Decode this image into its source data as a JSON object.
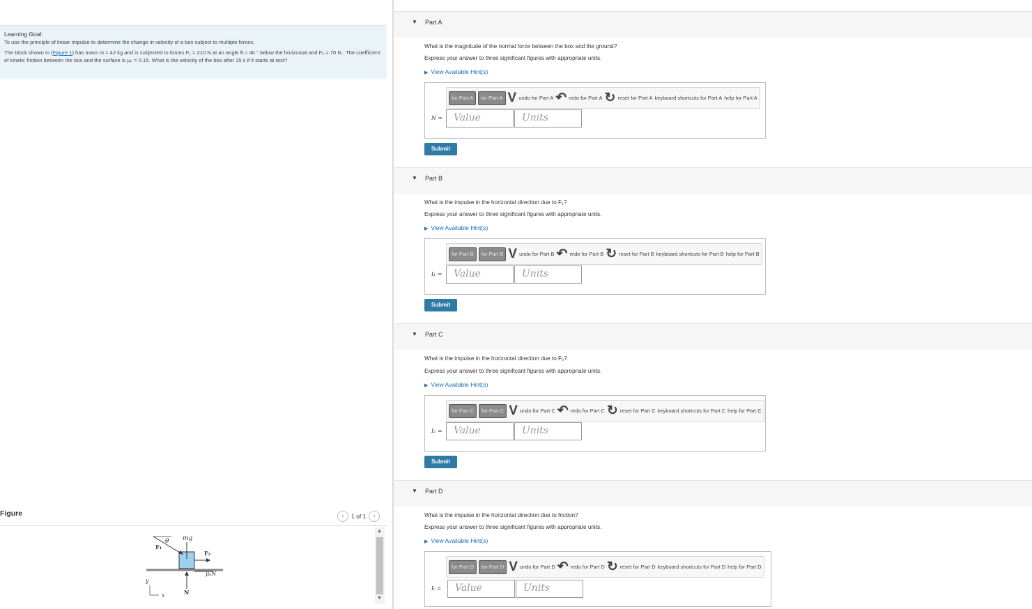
{
  "learning_goal": {
    "title": "Learning Goal:",
    "intro": "To use the principle of linear impulse to determine the change in velocity of a box subject to multiple forces.",
    "problem_prefix": "The block shown in (",
    "figure_link": "Figure 1",
    "problem_suffix": ") has mass m = 42 kg and is subjected to forces F₁ = 210 N at an angle θ = 40 ° below the horizontal and F₂ = 70 N . The coefficient of kinetic friction between the box and the surface is μₖ = 0.15. What is the velocity of the box after 15 s if it starts at rest?"
  },
  "figure": {
    "label": "Figure",
    "count": "1 of 1",
    "prev_icon": "chevron-left-icon",
    "next_icon": "chevron-right-icon",
    "labels": {
      "theta": "θ",
      "mg": "mg",
      "f1": "F₁",
      "f2": "F₂",
      "friction": "μₖN",
      "normal": "N",
      "y": "y",
      "x": "x"
    }
  },
  "parts": [
    {
      "title": "Part A",
      "question": "What is the magnitude of the normal force between the box and the ground?",
      "instruction": "Express your answer to three significant figures with appropriate units.",
      "hint": "View Available Hint(s)",
      "toolbar": {
        "btn1": "for Part A",
        "btn2": "for Part A",
        "undo": "undo for Part A",
        "redo": "redo for Part A",
        "reset": "reset for Part A",
        "shortcuts": "keyboard shortcuts for Part A",
        "help": "help for Part A"
      },
      "variable": "N =",
      "value_placeholder": "Value",
      "units_placeholder": "Units",
      "submit": "Submit"
    },
    {
      "title": "Part B",
      "question": "What is the impulse in the horizontal direction due to F₁?",
      "instruction": "Express your answer to three significant figures with appropriate units.",
      "hint": "View Available Hint(s)",
      "toolbar": {
        "btn1": "for Part B",
        "btn2": "for Part B",
        "undo": "undo for Part B",
        "redo": "redo for Part B",
        "reset": "reset for Part B",
        "shortcuts": "keyboard shortcuts for Part B",
        "help": "help for Part B"
      },
      "variable": "I₁ =",
      "value_placeholder": "Value",
      "units_placeholder": "Units",
      "submit": "Submit"
    },
    {
      "title": "Part C",
      "question": "What is the impulse in the horizontal direction due to F₂?",
      "instruction": "Express your answer to three significant figures with appropriate units.",
      "hint": "View Available Hint(s)",
      "toolbar": {
        "btn1": "for Part C",
        "btn2": "for Part C",
        "undo": "undo for Part C",
        "redo": "redo for Part C",
        "reset": "reset for Part C",
        "shortcuts": "keyboard shortcuts for Part C",
        "help": "help for Part C"
      },
      "variable": "I₂ =",
      "value_placeholder": "Value",
      "units_placeholder": "Units",
      "submit": "Submit"
    },
    {
      "title": "Part D",
      "question": "What is the impulse in the horizontal direction due to friction?",
      "instruction": "Express your answer to three significant figures with appropriate units.",
      "hint": "View Available Hint(s)",
      "toolbar": {
        "btn1": "for Part D",
        "btn2": "for Part D",
        "undo": "undo for Part D",
        "redo": "redo for Part D",
        "reset": "reset for Part D",
        "shortcuts": "keyboard shortcuts for Part D",
        "help": "help for Part D"
      },
      "variable": "Iₜ =",
      "value_placeholder": "Value",
      "units_placeholder": "Units"
    }
  ]
}
